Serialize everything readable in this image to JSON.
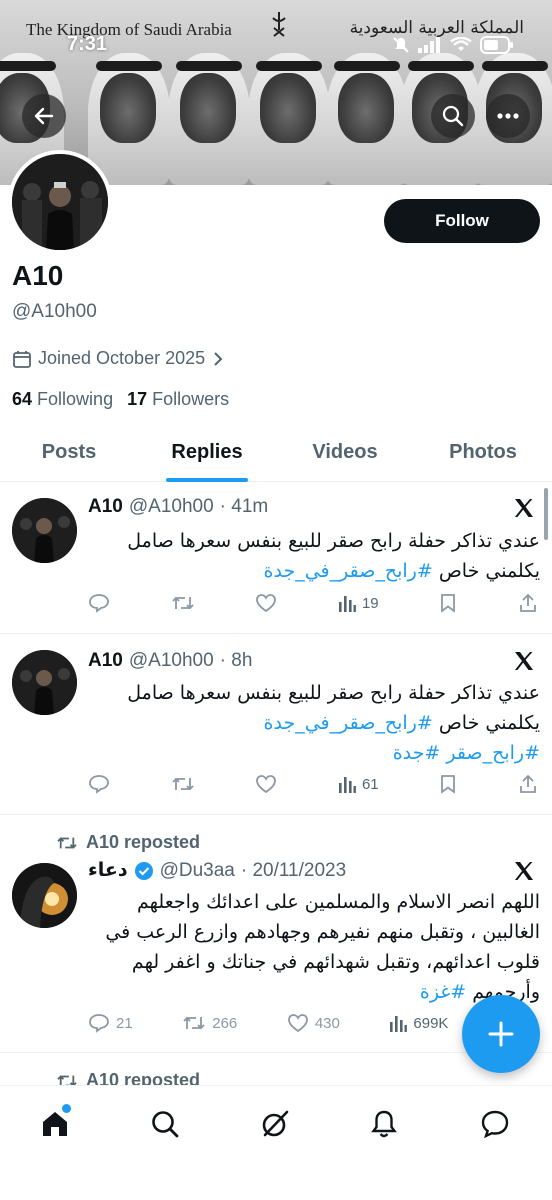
{
  "status_bar": {
    "time": "7:31"
  },
  "banner": {
    "title_en": "The Kingdom of Saudi Arabia",
    "title_ar": "المملكة العربية السعودية"
  },
  "profile": {
    "display_name": "A10",
    "handle": "@A10h00",
    "joined": "Joined October 2025",
    "following_count": "64",
    "following_label": "Following",
    "followers_count": "17",
    "followers_label": "Followers",
    "follow_label": "Follow"
  },
  "tabs": [
    {
      "label": "Posts",
      "active": false
    },
    {
      "label": "Replies",
      "active": true
    },
    {
      "label": "Videos",
      "active": false
    },
    {
      "label": "Photos",
      "active": false
    }
  ],
  "posts": [
    {
      "name": "A10",
      "handle": "@A10h00",
      "time": "· 41m",
      "text": "عندي تذاكر حفلة رابح صقر للبيع بنفس سعرها صامل يكلمني خاص",
      "hashtags": "#رابح_صقر_في_جدة",
      "views": "19"
    },
    {
      "name": "A10",
      "handle": "@A10h00",
      "time": "· 8h",
      "text": "عندي تذاكر حفلة رابح صقر للبيع بنفس سعرها صامل يكلمني خاص",
      "hashtags": "#رابح_صقر_في_جدة",
      "hashtags2": "#رابح_صقر #جدة",
      "views": "61"
    },
    {
      "repost_label": "A10 reposted",
      "name": "دعاء",
      "handle": "@Du3aa",
      "time": "· 20/11/2023",
      "text": "اللهم انصر الاسلام والمسلمين على اعدائك واجعلهم الغالبين ، وتقبل منهم نفيرهم وجهادهم وازرع الرعب في قلوب اعدائهم، وتقبل شهدائهم في جناتك و اغفر لهم وأرحمهم",
      "hashtags": "#غزة",
      "replies": "21",
      "reposts": "266",
      "likes": "430",
      "views": "699K"
    }
  ],
  "partial_repost_label": "A10 reposted",
  "colors": {
    "accent": "#1d9bf0",
    "text": "#0f1419",
    "muted": "#536471"
  },
  "bottom_nav": [
    "home-icon",
    "search-icon",
    "grok-icon",
    "notifications-icon",
    "messages-icon"
  ]
}
